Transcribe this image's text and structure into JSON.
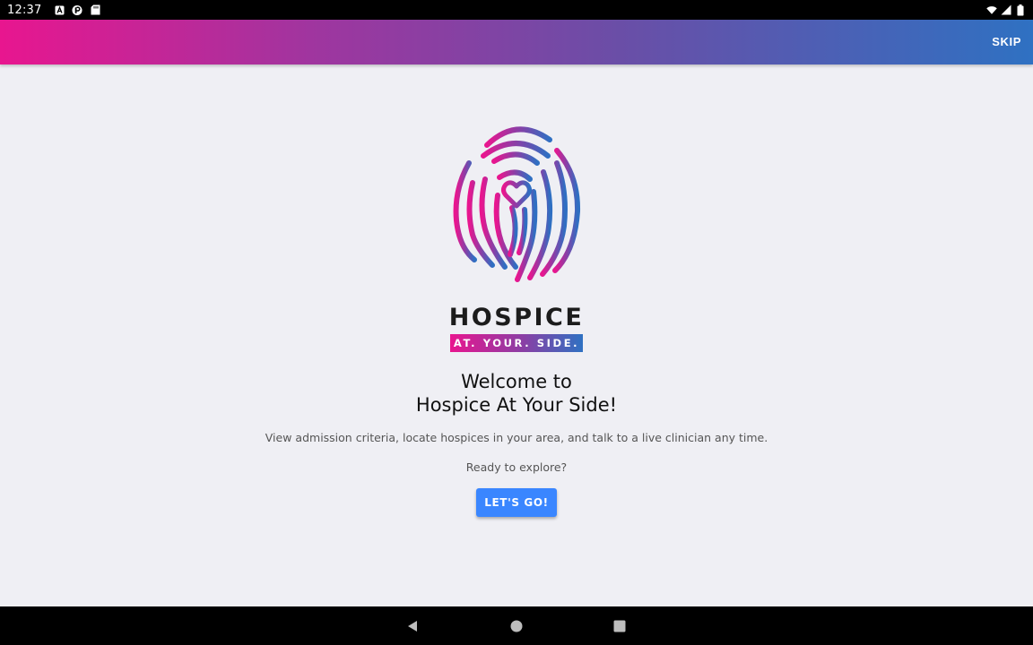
{
  "status_bar": {
    "time": "12:37",
    "icons_left": [
      "a-notification-icon",
      "brand-notification-icon",
      "sd-card-icon"
    ],
    "icons_right": [
      "wifi-icon",
      "signal-icon",
      "battery-icon"
    ]
  },
  "app_bar": {
    "skip_label": "SKIP",
    "gradient": [
      "#e8168f",
      "#a0359f",
      "#6a4ea7",
      "#2f71c2"
    ]
  },
  "logo": {
    "icon": "fingerprint-heart-icon",
    "word": "HOSPICE",
    "tagline": "AT. YOUR. SIDE."
  },
  "welcome": {
    "line1": "Welcome to",
    "line2": "Hospice At Your Side!"
  },
  "description": "View admission criteria, locate hospices in your area, and talk to a live clinician any time.",
  "prompt": "Ready to explore?",
  "cta": {
    "label": "LET'S GO!",
    "color": "#3a86ff"
  },
  "nav_bar": {
    "buttons": [
      "back-icon",
      "home-icon",
      "recents-icon"
    ]
  }
}
